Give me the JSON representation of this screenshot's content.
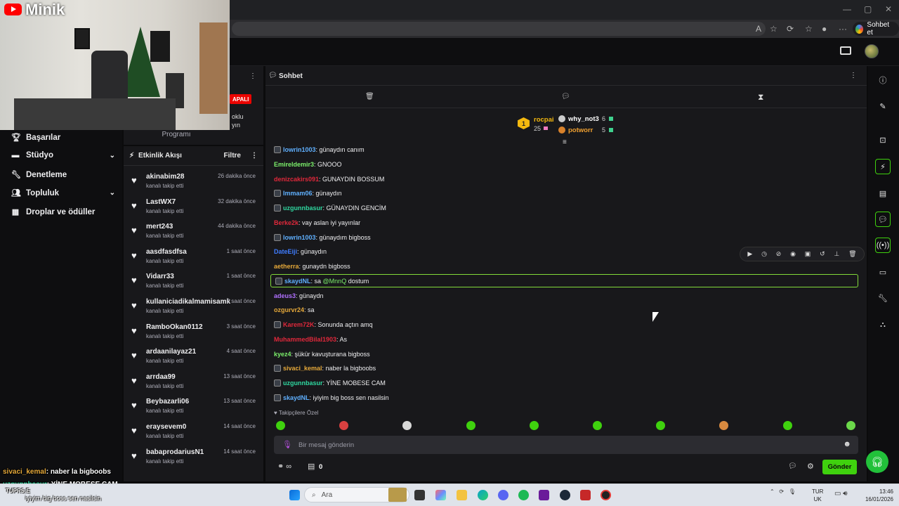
{
  "browser": {
    "ai_button_label": "Sohbet et"
  },
  "webcam": {
    "channel_name": "Minik"
  },
  "sidebar": {
    "items": [
      {
        "label": "Başarılar",
        "icon": "trophy-icon",
        "expandable": false
      },
      {
        "label": "Stüdyo",
        "icon": "studio-icon",
        "expandable": true
      },
      {
        "label": "Denetleme",
        "icon": "wrench-icon",
        "expandable": false
      },
      {
        "label": "Topluluk",
        "icon": "community-icon",
        "expandable": true
      },
      {
        "label": "Droplar ve ödüller",
        "icon": "gift-icon",
        "expandable": false
      }
    ]
  },
  "stream_panel": {
    "status_badge": "APALI",
    "text_line1": "oklu",
    "text_line2": "yın",
    "program_label": "Programı"
  },
  "activity_feed": {
    "title": "Etkinlik Akışı",
    "filter_label": "Filtre",
    "events": [
      {
        "name": "akinabim28",
        "action": "kanalı takip etti",
        "time": "26 dakika önce"
      },
      {
        "name": "LastWX7",
        "action": "kanalı takip etti",
        "time": "32 dakika önce"
      },
      {
        "name": "mert243",
        "action": "kanalı takip etti",
        "time": "44 dakika önce"
      },
      {
        "name": "aasdfasdfsa",
        "action": "kanalı takip etti",
        "time": "1 saat önce"
      },
      {
        "name": "Vidarr33",
        "action": "kanalı takip etti",
        "time": "1 saat önce"
      },
      {
        "name": "kullaniciadikalmamisamk",
        "action": "kanalı takip etti",
        "time": "2 saat önce"
      },
      {
        "name": "RamboOkan0112",
        "action": "kanalı takip etti",
        "time": "3 saat önce"
      },
      {
        "name": "ardaanilayaz21",
        "action": "kanalı takip etti",
        "time": "4 saat önce"
      },
      {
        "name": "arrdaa99",
        "action": "kanalı takip etti",
        "time": "13 saat önce"
      },
      {
        "name": "Beybazarli06",
        "action": "kanalı takip etti",
        "time": "13 saat önce"
      },
      {
        "name": "eraysevem0",
        "action": "kanalı takip etti",
        "time": "14 saat önce"
      },
      {
        "name": "babaprodariusN1",
        "action": "kanalı takip etti",
        "time": "14 saat önce"
      }
    ]
  },
  "chat": {
    "title": "Sohbet",
    "leaderboard": {
      "first": {
        "rank": "1",
        "name": "rocpai",
        "count": "25"
      },
      "second": {
        "name": "why_not3",
        "count": "6"
      },
      "third": {
        "name": "potworr",
        "count": "5"
      }
    },
    "messages": [
      {
        "user": "lowrin1003",
        "color": "#5fb0ff",
        "badge": true,
        "text": ": günaydın canım"
      },
      {
        "user": "Emireldemir3",
        "color": "#7cf06b",
        "badge": false,
        "text": ": GNOOO"
      },
      {
        "user": "denizcakirs091",
        "color": "#e0283b",
        "badge": false,
        "text": ": GUNAYDIN BOSSUM"
      },
      {
        "user": "Immam06",
        "color": "#5fb0ff",
        "badge": true,
        "text": ": günaydın"
      },
      {
        "user": "uzgunnbasur",
        "color": "#2fd8a0",
        "badge": true,
        "text": ": GÜNAYDIN GENCİM"
      },
      {
        "user": "Berke2k",
        "color": "#e0283b",
        "badge": false,
        "text": ": vay aslan iyi yayınlar"
      },
      {
        "user": "lowrin1003",
        "color": "#5fb0ff",
        "badge": true,
        "text": ": günaydım bigboss"
      },
      {
        "user": "DateEiji",
        "color": "#3f7cff",
        "badge": false,
        "text": ": günaydın"
      },
      {
        "user": "aetherra",
        "color": "#e6a93a",
        "badge": false,
        "text": ": gunaydn bigboss"
      },
      {
        "user": "skaydNL",
        "color": "#5fb0ff",
        "badge": true,
        "text": ": sa ",
        "mention": "@MnnQ",
        "after": " dostum"
      },
      {
        "user": "adeus3",
        "color": "#b070ff",
        "badge": false,
        "text": ": günaydn"
      },
      {
        "user": "ozgurvr24",
        "color": "#e6a93a",
        "badge": false,
        "text": ": sa"
      },
      {
        "user": "Karem72K",
        "color": "#e0283b",
        "badge": true,
        "text": ": Sonunda açtın amq"
      },
      {
        "user": "MuhammedBilal1903",
        "color": "#e0283b",
        "badge": false,
        "text": ": As"
      },
      {
        "user": "kyez4",
        "color": "#7cf06b",
        "badge": false,
        "text": ": şükür kavuşturana bigboss"
      },
      {
        "user": "sivaci_kemal",
        "color": "#e6a93a",
        "badge": true,
        "text": ": naber la bigboobs"
      },
      {
        "user": "uzgunnbasur",
        "color": "#2fd8a0",
        "badge": true,
        "text": ": YİNE MOBESE CAM"
      },
      {
        "user": "skaydNL",
        "color": "#5fb0ff",
        "badge": true,
        "text": ": iyiyim big boss sen nasilsin"
      }
    ],
    "followers_only_label": "Takipçilere Özel",
    "input_placeholder": "Bir mesaj gönderin",
    "points_value": "0",
    "send_label": "Gönder",
    "highlight_color": "#83db3a",
    "accent_color": "#3fd10e"
  },
  "overlay": {
    "line1_user": "sivaci_kemal",
    "line1_text": ": naber la bigboobs",
    "line2_user": "uzgunnbasur",
    "line2_text": ": YİNE MOBESE CAM",
    "line3_text": "iyiyim big boss sen nasilsin",
    "ticker_label": "TUPRS.E"
  },
  "taskbar": {
    "search_placeholder": "Ara",
    "lang_line1": "TUR",
    "lang_line2": "UK",
    "time": "13:46",
    "date": "16/01/2026"
  }
}
